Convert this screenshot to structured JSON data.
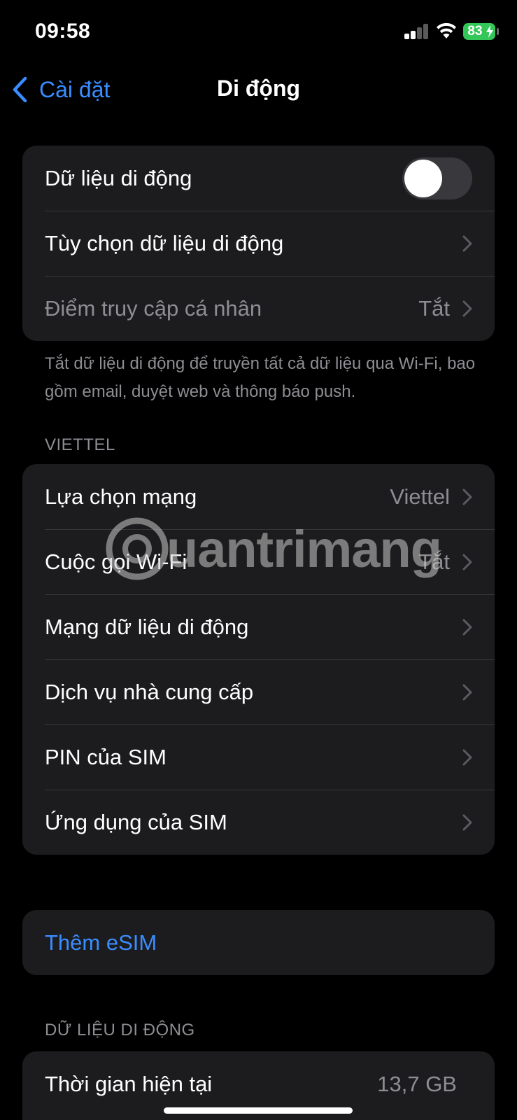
{
  "status_bar": {
    "time": "09:58",
    "battery_level": "83",
    "signal_icon": "cellular-signal-icon",
    "wifi_icon": "wifi-icon",
    "battery_icon": "battery-charging-icon",
    "battery_color": "#33c759"
  },
  "nav": {
    "back_label": "Cài đặt",
    "title": "Di động",
    "accent": "#3a8dff"
  },
  "group1": {
    "cellular_data_label": "Dữ liệu di động",
    "cellular_data_enabled": false,
    "options_label": "Tùy chọn dữ liệu di động",
    "hotspot_label": "Điểm truy cập cá nhân",
    "hotspot_value": "Tắt"
  },
  "group1_footer": "Tắt dữ liệu di động để truyền tất cả dữ liệu qua Wi-Fi, bao gồm email, duyệt web và thông báo push.",
  "carrier_section": {
    "header": "VIETTEL",
    "items": [
      {
        "label": "Lựa chọn mạng",
        "value": "Viettel"
      },
      {
        "label": "Cuộc gọi Wi-Fi",
        "value": "Tắt"
      },
      {
        "label": "Mạng dữ liệu di động",
        "value": ""
      },
      {
        "label": "Dịch vụ nhà cung cấp",
        "value": ""
      },
      {
        "label": "PIN của SIM",
        "value": ""
      },
      {
        "label": "Ứng dụng của SIM",
        "value": ""
      }
    ]
  },
  "esim": {
    "label": "Thêm eSIM"
  },
  "usage_section": {
    "header": "DỮ LIỆU DI ĐỘNG",
    "current_period_label": "Thời gian hiện tại",
    "current_period_value": "13,7 GB"
  },
  "watermark": {
    "text": "uantrimang"
  }
}
